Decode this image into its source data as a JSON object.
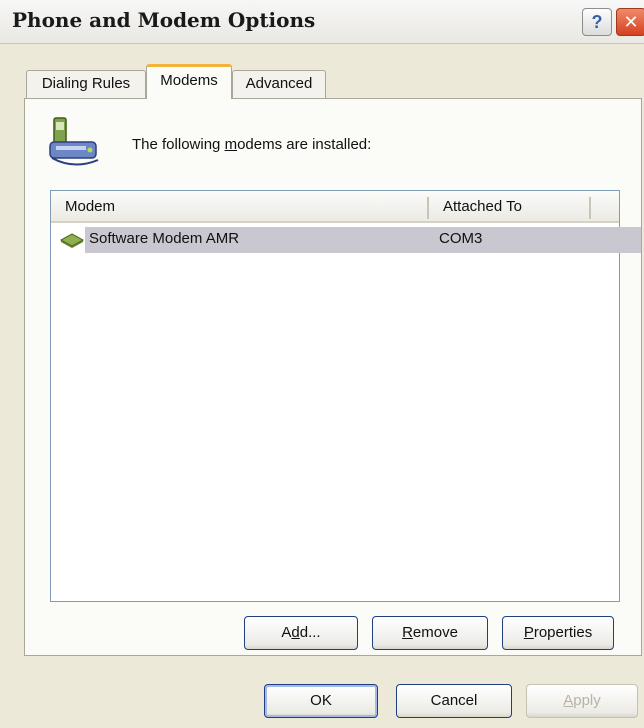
{
  "window": {
    "title": "Phone and Modem Options",
    "help_label": "?",
    "close_label": "✕"
  },
  "tabs": [
    {
      "label": "Dialing Rules",
      "active": false
    },
    {
      "label": "Modems",
      "active": true
    },
    {
      "label": "Advanced",
      "active": false
    }
  ],
  "modems_tab": {
    "info_pre": "The following ",
    "info_accel": "m",
    "info_post": "odems are  installed:",
    "columns": [
      "Modem",
      "Attached To"
    ],
    "rows": [
      {
        "modem": "Software Modem AMR",
        "attached_to": "COM3",
        "selected": true,
        "icon": "modem-icon"
      }
    ],
    "buttons": {
      "add_pre": "A",
      "add_accel": "d",
      "add_post": "d...",
      "remove_accel": "R",
      "remove_post": "emove",
      "properties_accel": "P",
      "properties_post": "roperties"
    }
  },
  "dialog_buttons": {
    "ok": "OK",
    "cancel": "Cancel",
    "apply_accel": "A",
    "apply_post": "pply",
    "apply_enabled": false
  },
  "colors": {
    "selection": "#c9c7cf",
    "tab_highlight": "#f2b33d",
    "close_button": "#d4401f"
  }
}
